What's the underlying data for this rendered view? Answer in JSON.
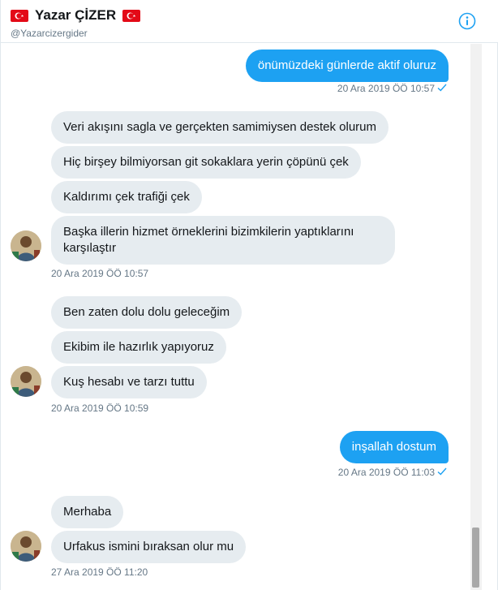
{
  "header": {
    "display_name": "Yazar ÇİZER",
    "handle": "@Yazarcizergider",
    "flag_icon": "turkey-flag-icon",
    "info_icon": "info-icon"
  },
  "colors": {
    "accent": "#1da1f2",
    "incoming_bubble": "#e6ecf0",
    "meta_text": "#657786"
  },
  "messages": [
    {
      "dir": "out",
      "text": "önümüzdeki günlerde aktif oluruz"
    },
    {
      "dir": "in",
      "text": "Veri akışını sagla ve gerçekten samimiysen destek olurum"
    },
    {
      "dir": "in",
      "text": "Hiç birşey bilmiyorsan git sokaklara yerin çöpünü çek"
    },
    {
      "dir": "in",
      "text": "Kaldırımı çek trafiği çek"
    },
    {
      "dir": "in",
      "text": "Başka illerin hizmet örneklerini bizimkilerin yaptıklarını karşılaştır"
    },
    {
      "dir": "in",
      "text": "Ben zaten dolu dolu geleceğim"
    },
    {
      "dir": "in",
      "text": "Ekibim ile hazırlık yapıyoruz"
    },
    {
      "dir": "in",
      "text": "Kuş hesabı ve tarzı tuttu"
    },
    {
      "dir": "out",
      "text": "inşallah dostum"
    },
    {
      "dir": "in",
      "text": "Merhaba"
    },
    {
      "dir": "in",
      "text": "Urfakus ismini bıraksan olur mu"
    }
  ],
  "timestamps": [
    "20 Ara 2019 ÖÖ 10:57",
    "20 Ara 2019 ÖÖ 10:57",
    "20 Ara 2019 ÖÖ 10:59",
    "20 Ara 2019 ÖÖ 11:03",
    "27 Ara 2019 ÖÖ 11:20"
  ],
  "read_icon": "checkmark-icon"
}
